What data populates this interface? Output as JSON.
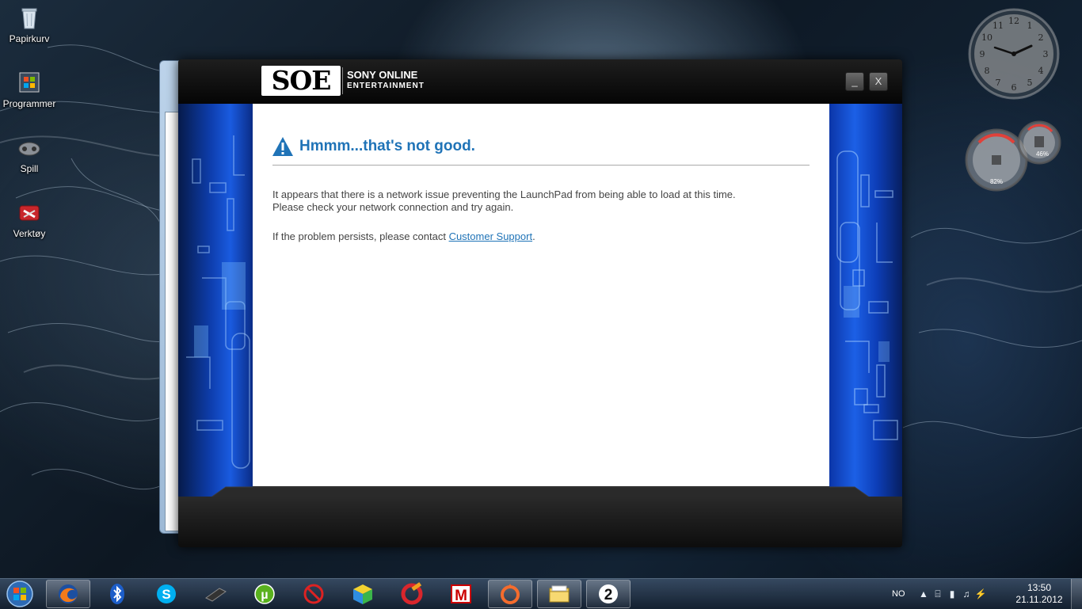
{
  "desktop": {
    "icons": [
      {
        "label": "Papirkurv",
        "icon": "recycle-bin-icon"
      },
      {
        "label": "Programmer",
        "icon": "programs-icon"
      },
      {
        "label": "Spill",
        "icon": "games-icon"
      },
      {
        "label": "Verktøy",
        "icon": "tools-icon"
      }
    ],
    "gadgets": {
      "meter_left": "82%",
      "meter_right": "46%"
    }
  },
  "launcher": {
    "logo": "SOE",
    "brand_line1": "SONY ONLINE",
    "brand_line2": "ENTERTAINMENT",
    "minimize_label": "_",
    "close_label": "X",
    "error_title": "Hmmm...that's not good.",
    "message_line1": "It appears that there is a network issue preventing the LaunchPad from being able to load at this time.",
    "message_line2": "Please check your network connection and try again.",
    "support_prefix": "If the problem persists, please contact ",
    "support_link": "Customer Support",
    "support_suffix": ".",
    "accent_color": "#1f73b7"
  },
  "taskbar": {
    "items": [
      {
        "name": "firefox-icon"
      },
      {
        "name": "bluetooth-icon"
      },
      {
        "name": "skype-icon"
      },
      {
        "name": "ps3-icon"
      },
      {
        "name": "utorrent-icon"
      },
      {
        "name": "blocked-app-icon"
      },
      {
        "name": "rubik-cube-icon"
      },
      {
        "name": "ccleaner-icon"
      },
      {
        "name": "malwarebytes-icon"
      },
      {
        "name": "origin-icon"
      },
      {
        "name": "file-explorer-icon"
      },
      {
        "name": "soe-launcher-icon"
      }
    ],
    "language": "NO",
    "time": "13:50",
    "date": "21.11.2012"
  }
}
